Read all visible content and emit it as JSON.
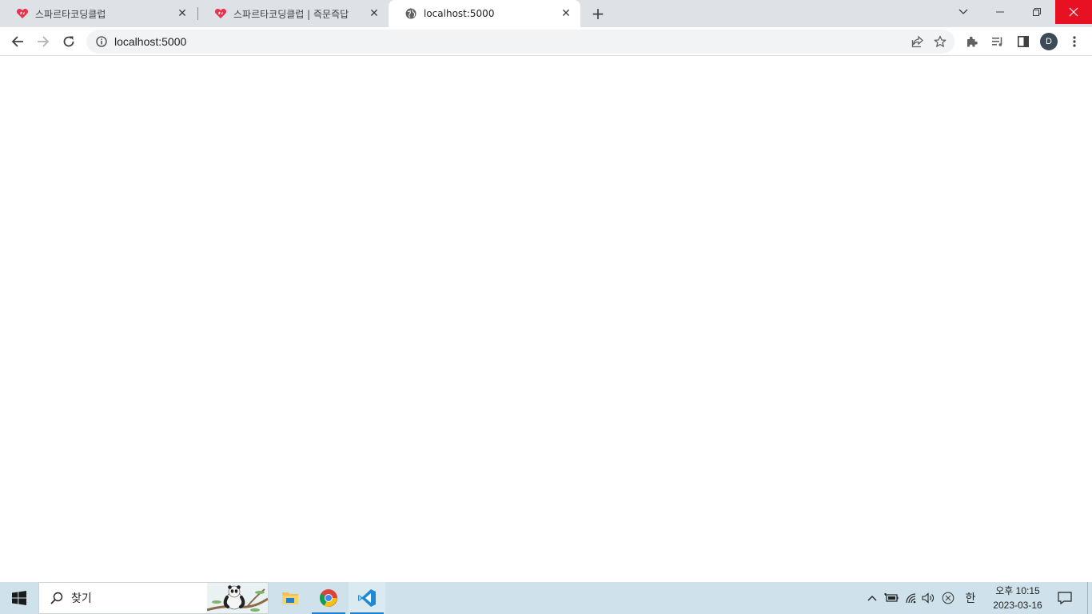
{
  "browser": {
    "tabs": [
      {
        "title": "스파르타코딩클럽",
        "favicon": "sparta-heart-icon",
        "active": false
      },
      {
        "title": "스파르타코딩클럽 | 즉문즉답",
        "favicon": "sparta-heart-icon",
        "active": false
      },
      {
        "title": "localhost:5000",
        "favicon": "globe-icon",
        "active": true
      }
    ],
    "address": {
      "url": "localhost:5000"
    },
    "profile_initial": "D",
    "colors": {
      "tabstrip": "#dee1e6",
      "close_button": "#e81123",
      "accent_heart": "#e8344e"
    }
  },
  "taskbar": {
    "search_placeholder": "찾기",
    "apps": [
      "file-explorer-icon",
      "chrome-icon",
      "vscode-icon"
    ],
    "tray": {
      "ime": "한"
    },
    "clock": {
      "time": "오후 10:15",
      "date": "2023-03-16"
    },
    "colors": {
      "background": "#cfe1eb",
      "running_indicator": "#1f7fd1"
    }
  }
}
